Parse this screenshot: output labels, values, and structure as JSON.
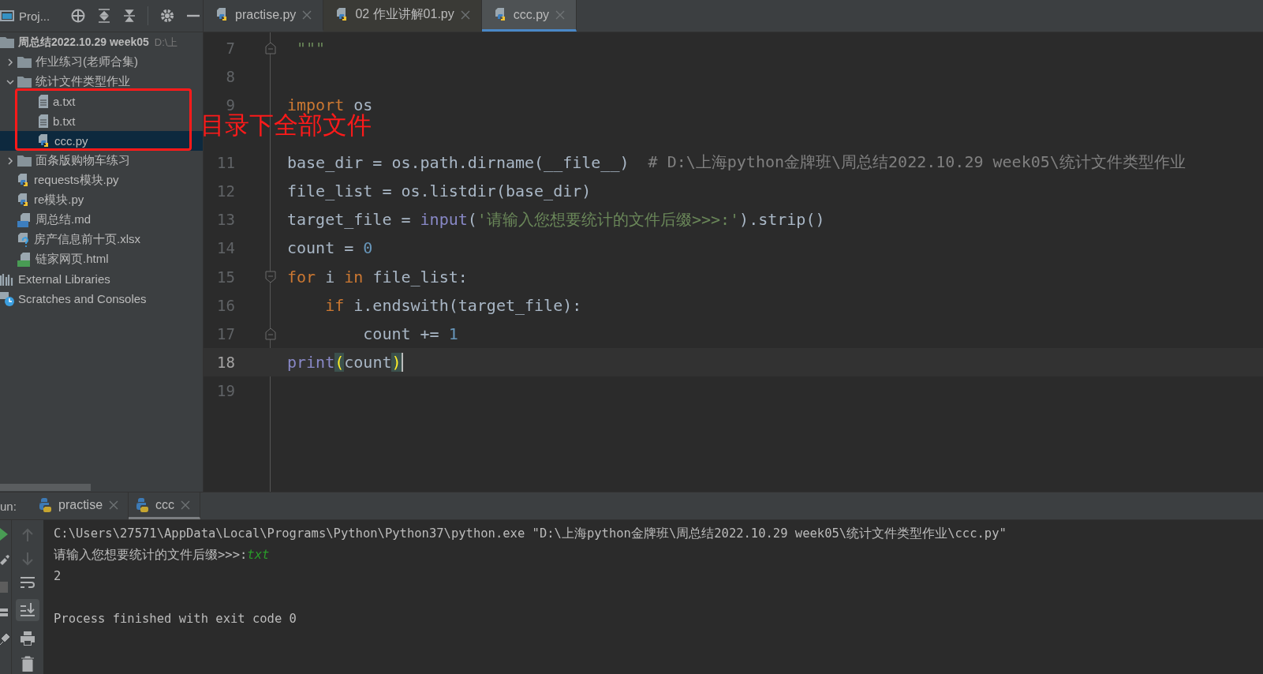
{
  "project_panel": {
    "title": "Proj...",
    "tree": [
      {
        "label": "周总结2022.10.29 week05",
        "hint": "D:\\上",
        "kind": "folder",
        "selected": false,
        "children": [
          {
            "label": "作业练习(老师合集)",
            "kind": "folder",
            "expanded": false,
            "selected": false
          },
          {
            "label": "统计文件类型作业",
            "kind": "folder",
            "expanded": true,
            "selected": false,
            "children": [
              {
                "label": "a.txt",
                "kind": "text",
                "selected": false
              },
              {
                "label": "b.txt",
                "kind": "text",
                "selected": false
              },
              {
                "label": "ccc.py",
                "kind": "python",
                "selected": true
              }
            ]
          },
          {
            "label": "面条版购物车练习",
            "kind": "folder",
            "expanded": false,
            "selected": false
          },
          {
            "label": "requests模块.py",
            "kind": "python",
            "selected": false
          },
          {
            "label": "re模块.py",
            "kind": "python",
            "selected": false
          },
          {
            "label": "周总结.md",
            "kind": "markdown",
            "selected": false
          },
          {
            "label": "房产信息前十页.xlsx",
            "kind": "unknown",
            "selected": false
          },
          {
            "label": "链家网页.html",
            "kind": "html",
            "selected": false
          }
        ]
      },
      {
        "label": "External Libraries",
        "kind": "libraries",
        "selected": false
      },
      {
        "label": "Scratches and Consoles",
        "kind": "scratches",
        "selected": false
      }
    ]
  },
  "editor_tabs": [
    {
      "label": "practise.py",
      "selected": false
    },
    {
      "label": "02 作业讲解01.py",
      "selected": false
    },
    {
      "label": "ccc.py",
      "selected": true
    }
  ],
  "code_lines": [
    {
      "number": "7",
      "current": false,
      "fold_start": false,
      "fold_end": true,
      "tokens": [
        {
          "text": " \"\"\"",
          "kind": "string"
        }
      ]
    },
    {
      "number": "8",
      "current": false,
      "fold_start": false,
      "fold_end": false
    },
    {
      "number": "9",
      "current": false,
      "fold_start": false,
      "fold_end": false,
      "tokens": [
        {
          "text": "import",
          "kind": "keyword"
        },
        {
          "text": " os",
          "kind": "plain"
        }
      ]
    },
    {
      "current": false,
      "fold_start": false,
      "fold_end": false
    },
    {
      "number": "11",
      "current": false,
      "fold_start": false,
      "fold_end": false,
      "tokens": [
        {
          "text": "base_dir = os.path.dirname(__file__)  ",
          "kind": "plain"
        },
        {
          "text": "# D:\\上海python金牌班\\周总结2022.10.29 week05\\统计文件类型作业",
          "kind": "comment"
        }
      ]
    },
    {
      "number": "12",
      "current": false,
      "fold_start": false,
      "fold_end": false,
      "tokens": [
        {
          "text": "file_list = os.listdir(base_dir)",
          "kind": "plain"
        }
      ]
    },
    {
      "number": "13",
      "current": false,
      "fold_start": false,
      "fold_end": false,
      "tokens": [
        {
          "text": "target_file = ",
          "kind": "plain"
        },
        {
          "text": "input",
          "kind": "builtin"
        },
        {
          "text": "(",
          "kind": "plain"
        },
        {
          "text": "'请输入您想要统计的文件后缀>>>:'",
          "kind": "string"
        },
        {
          "text": ").strip()",
          "kind": "plain"
        }
      ]
    },
    {
      "number": "14",
      "current": false,
      "fold_start": false,
      "fold_end": false,
      "tokens": [
        {
          "text": "count = ",
          "kind": "plain"
        },
        {
          "text": "0",
          "kind": "number"
        }
      ]
    },
    {
      "number": "15",
      "current": false,
      "fold_start": true,
      "fold_end": false,
      "tokens": [
        {
          "text": "for",
          "kind": "keyword"
        },
        {
          "text": " i ",
          "kind": "plain"
        },
        {
          "text": "in",
          "kind": "keyword"
        },
        {
          "text": " file_list:",
          "kind": "plain"
        }
      ]
    },
    {
      "number": "16",
      "current": false,
      "fold_start": false,
      "fold_end": false,
      "tokens": [
        {
          "text": "    if",
          "kind": "keyword"
        },
        {
          "text": " i.endswith(target_file):",
          "kind": "plain"
        }
      ]
    },
    {
      "number": "17",
      "current": false,
      "fold_start": false,
      "fold_end": true,
      "tokens": [
        {
          "text": "        count += ",
          "kind": "plain"
        },
        {
          "text": "1",
          "kind": "number"
        }
      ]
    },
    {
      "number": "18",
      "current": true,
      "fold_start": false,
      "fold_end": false,
      "tokens": [
        {
          "text": "print",
          "kind": "builtin"
        },
        {
          "text": "(",
          "kind": "brace"
        },
        {
          "text": "count",
          "kind": "plain"
        },
        {
          "text": ")",
          "kind": "brace"
        }
      ]
    },
    {
      "number": "19",
      "current": false,
      "fold_start": false,
      "fold_end": false
    }
  ],
  "annotation": {
    "text": "目录下全部文件"
  },
  "run_panel": {
    "label": "un:",
    "tabs": [
      {
        "label": "practise",
        "selected": false
      },
      {
        "label": "ccc",
        "selected": true
      }
    ],
    "console": [
      {
        "segments": [
          {
            "text": "C:\\Users\\27571\\AppData\\Local\\Programs\\Python\\Python37\\python.exe \"D:\\上海python金牌班\\周总结2022.10.29 week05\\统计文件类型作业\\ccc.py\"",
            "kind": "output"
          }
        ]
      },
      {
        "segments": [
          {
            "text": "请输入您想要统计的文件后缀>>>:",
            "kind": "output"
          },
          {
            "text": "txt",
            "kind": "input"
          }
        ]
      },
      {
        "segments": [
          {
            "text": "2",
            "kind": "output"
          }
        ]
      },
      {
        "segments": [
          {
            "text": "Process finished with exit code 0",
            "kind": "output"
          }
        ]
      }
    ]
  }
}
